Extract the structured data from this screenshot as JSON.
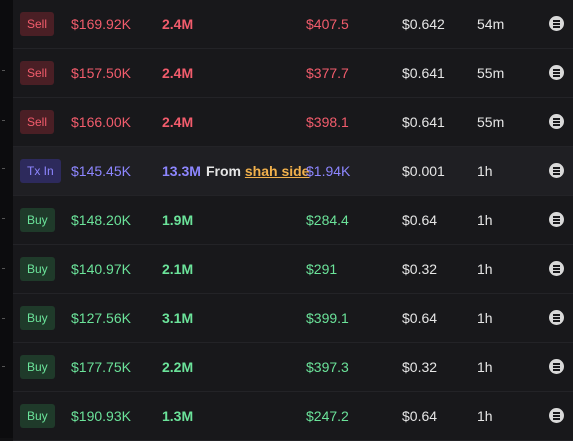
{
  "trades": [
    {
      "type": "sell",
      "badge": "Sell",
      "usd": "$169.92K",
      "amount": "2.4M",
      "price": "$407.5",
      "market_cap": "$0.642",
      "age": "54m"
    },
    {
      "type": "sell",
      "badge": "Sell",
      "usd": "$157.50K",
      "amount": "2.4M",
      "price": "$377.7",
      "market_cap": "$0.641",
      "age": "55m"
    },
    {
      "type": "sell",
      "badge": "Sell",
      "usd": "$166.00K",
      "amount": "2.4M",
      "price": "$398.1",
      "market_cap": "$0.641",
      "age": "55m"
    },
    {
      "type": "txin",
      "badge": "Tx In",
      "usd": "$145.45K",
      "amount": "13.3M",
      "from_label": "From",
      "from_name": "shah side",
      "price": "$1.94K",
      "market_cap": "$0.001",
      "age": "1h"
    },
    {
      "type": "buy",
      "badge": "Buy",
      "usd": "$148.20K",
      "amount": "1.9M",
      "price": "$284.4",
      "market_cap": "$0.64",
      "age": "1h"
    },
    {
      "type": "buy",
      "badge": "Buy",
      "usd": "$140.97K",
      "amount": "2.1M",
      "price": "$291",
      "market_cap": "$0.32",
      "age": "1h"
    },
    {
      "type": "buy",
      "badge": "Buy",
      "usd": "$127.56K",
      "amount": "3.1M",
      "price": "$399.1",
      "market_cap": "$0.64",
      "age": "1h"
    },
    {
      "type": "buy",
      "badge": "Buy",
      "usd": "$177.75K",
      "amount": "2.2M",
      "price": "$397.3",
      "market_cap": "$0.32",
      "age": "1h"
    },
    {
      "type": "buy",
      "badge": "Buy",
      "usd": "$190.93K",
      "amount": "1.3M",
      "price": "$247.2",
      "market_cap": "$0.64",
      "age": "1h"
    }
  ],
  "colors": {
    "sell": "#f25c6c",
    "buy": "#6be39a",
    "txin": "#8d86ff",
    "link": "#f2b14c"
  },
  "icons": {
    "row_menu": "list-menu-icon"
  }
}
